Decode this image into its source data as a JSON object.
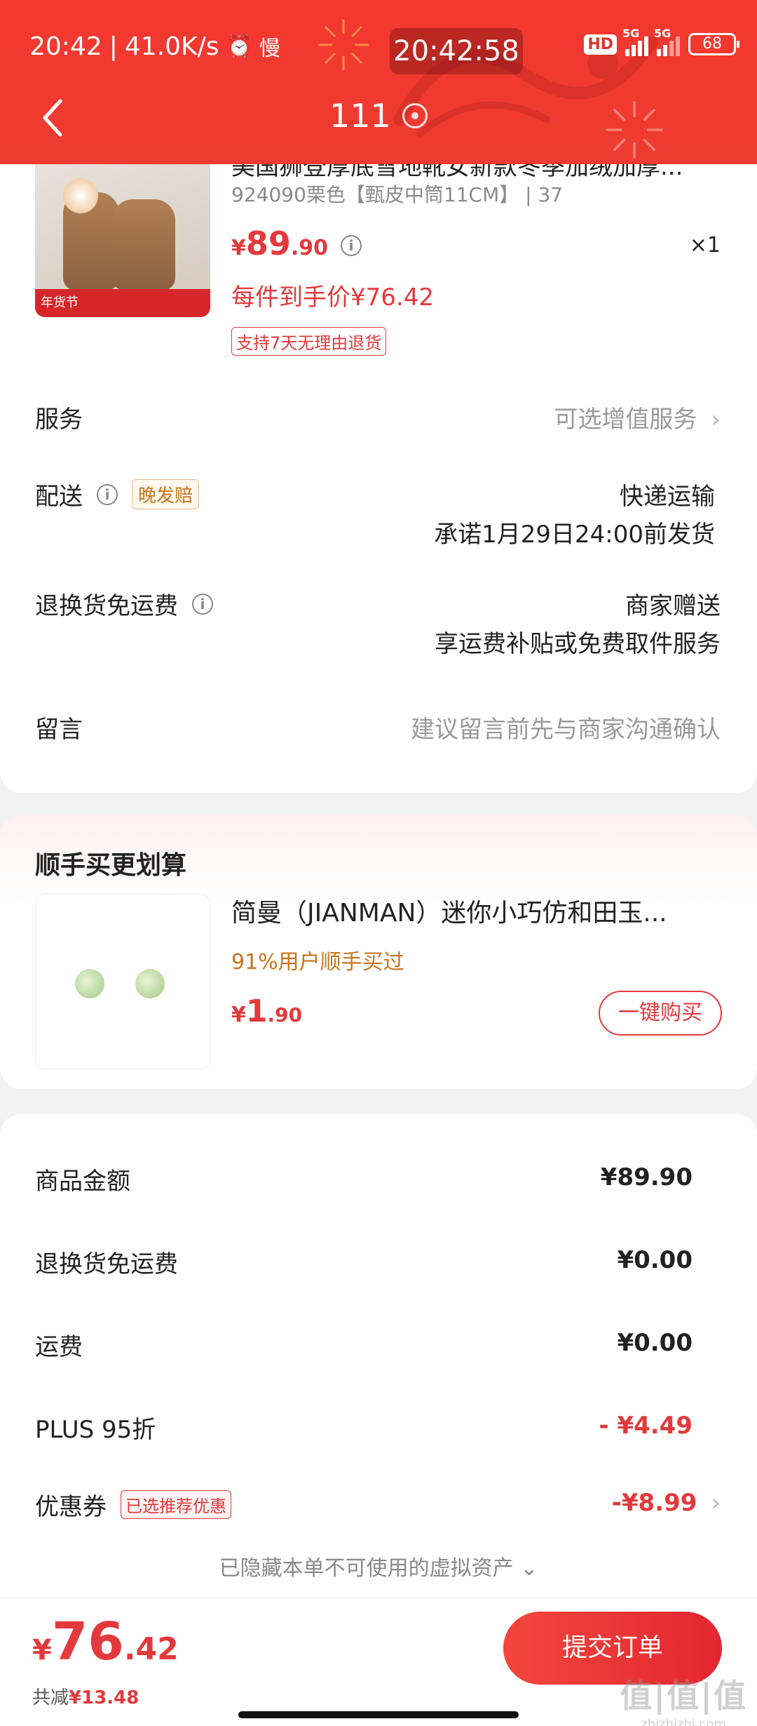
{
  "status_bar": {
    "time": "20:42",
    "net_speed": "41.0K/s",
    "alarm_icon": "alarm-icon",
    "app_badge": "慢",
    "center_time": "20:42:58",
    "hd_label": "HD",
    "network_1": "5G",
    "network_2": "5G",
    "battery": "68"
  },
  "nav": {
    "title": "111",
    "back_icon": "back-arrow-icon",
    "location_icon": "location-pin-icon"
  },
  "product": {
    "title": "美国狮登厚底雪地靴女新款冬季加绒加厚...",
    "sku": "924090栗色【甄皮中筒11CM】",
    "size": "37",
    "price_symbol": "¥",
    "price_int": "89",
    "price_dec": ".90",
    "quantity": "×1",
    "final_price": "每件到手价¥76.42",
    "return_tag": "支持7天无理由退货",
    "image_banner": "年货节"
  },
  "rows": {
    "service_label": "服务",
    "service_value": "可选增值服务",
    "delivery_label": "配送",
    "delivery_tag": "晚发赔",
    "delivery_method": "快递运输",
    "delivery_promise": "承诺1月29日24:00前发货",
    "return_label": "退换货免运费",
    "return_value1": "商家赠送",
    "return_value2": "享运费补贴或免费取件服务",
    "message_label": "留言",
    "message_placeholder": "建议留言前先与商家沟通确认"
  },
  "recommend": {
    "section_title": "顺手买更划算",
    "title": "简曼（JIANMAN）迷你小巧仿和田玉...",
    "subtitle": "91%用户顺手买过",
    "price_symbol": "¥",
    "price_int": "1",
    "price_dec": ".90",
    "buy_button": "一键购买"
  },
  "summary": {
    "goods_label": "商品金额",
    "goods_value": "¥89.90",
    "return_fee_label": "退换货免运费",
    "return_fee_value": "¥0.00",
    "shipping_label": "运费",
    "shipping_value": "¥0.00",
    "plus_label": "PLUS 95折",
    "plus_value": "- ¥4.49",
    "coupon_label": "优惠券",
    "coupon_tag": "已选推荐优惠",
    "coupon_value": "-¥8.99",
    "hidden_assets": "已隐藏本单不可使用的虚拟资产"
  },
  "footer": {
    "total_symbol": "¥",
    "total_int": "76",
    "total_dec": ".42",
    "saved_label": "共减",
    "saved_value": "¥13.48",
    "submit_button": "提交订单",
    "watermark": "值|值|值",
    "watermark_url": "zhizhizhi.com"
  },
  "colors": {
    "header_red": "#f03a30",
    "price_red": "#e4393c",
    "accent_orange": "#c8741c"
  }
}
